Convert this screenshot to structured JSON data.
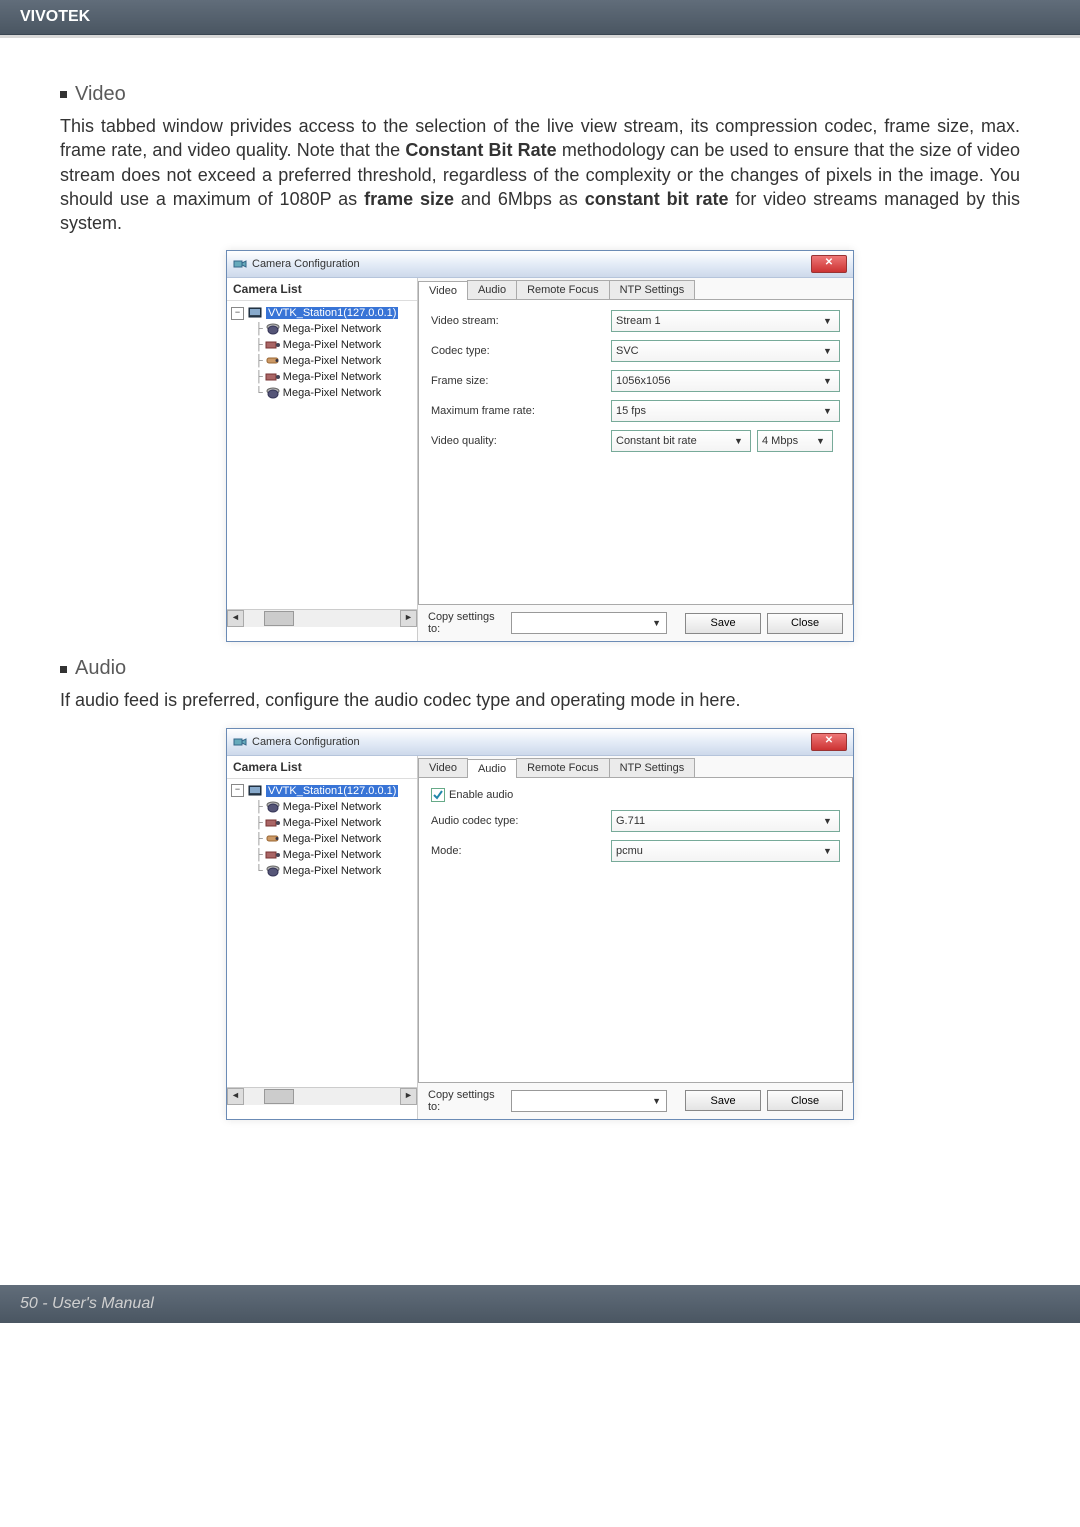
{
  "header": {
    "brand": "VIVOTEK"
  },
  "video_section": {
    "title": "Video",
    "paragraph_parts": {
      "p1a": "This tabbed window privides access to the selection of the live view stream, its compression codec, frame size, max. frame rate, and video quality. Note that the ",
      "p1b": "Constant Bit Rate",
      "p1c": " methodology can be used to ensure that the size of video stream does not exceed a preferred threshold, regardless of the complexity or the changes of pixels in the image. You should use a maximum of 1080P as ",
      "p1d": "frame size",
      "p1e": " and 6Mbps as ",
      "p1f": "constant bit rate",
      "p1g": " for video streams managed by this system."
    }
  },
  "audio_section": {
    "title": "Audio",
    "paragraph": "If audio feed is preferred, configure the audio codec type and operating mode in here."
  },
  "dialog": {
    "title": "Camera Configuration",
    "camera_list_header": "Camera List",
    "tree": {
      "root": "VVTK_Station1(127.0.0.1)",
      "children": [
        {
          "label": "Mega-Pixel Network",
          "type": "dome"
        },
        {
          "label": "Mega-Pixel Network",
          "type": "box"
        },
        {
          "label": "Mega-Pixel Network",
          "type": "bullet"
        },
        {
          "label": "Mega-Pixel Network",
          "type": "box"
        },
        {
          "label": "Mega-Pixel Network",
          "type": "dome"
        }
      ]
    },
    "tabs": {
      "video": "Video",
      "audio": "Audio",
      "remote_focus": "Remote Focus",
      "ntp": "NTP Settings"
    },
    "video_form": {
      "video_stream_label": "Video stream:",
      "video_stream_value": "Stream 1",
      "codec_label": "Codec type:",
      "codec_value": "SVC",
      "frame_size_label": "Frame size:",
      "frame_size_value": "1056x1056",
      "max_frame_rate_label": "Maximum frame rate:",
      "max_frame_rate_value": "15 fps",
      "video_quality_label": "Video quality:",
      "video_quality_value": "Constant bit rate",
      "bitrate_value": "4 Mbps"
    },
    "audio_form": {
      "enable_audio_label": "Enable audio",
      "codec_label": "Audio codec type:",
      "codec_value": "G.711",
      "mode_label": "Mode:",
      "mode_value": "pcmu"
    },
    "bottom": {
      "copy_label": "Copy settings to:",
      "save": "Save",
      "close": "Close"
    }
  },
  "footer": {
    "text": "50 - User's Manual"
  }
}
